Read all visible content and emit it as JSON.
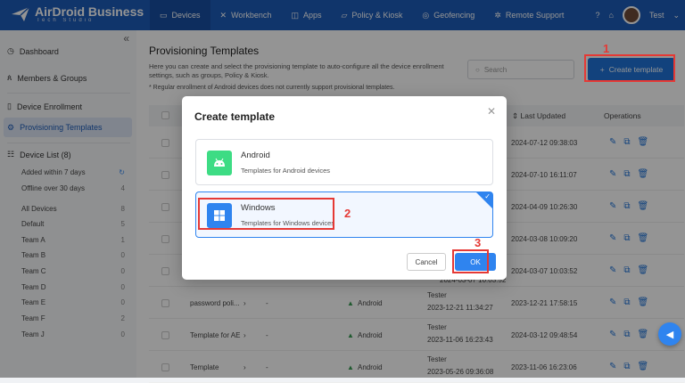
{
  "app": {
    "logo_text": "AirDroid Business",
    "logo_sub": "Tech Studio"
  },
  "nav": [
    {
      "label": "Devices",
      "icon": "devices-icon",
      "active": true
    },
    {
      "label": "Workbench",
      "icon": "workbench-icon"
    },
    {
      "label": "Apps",
      "icon": "apps-icon"
    },
    {
      "label": "Policy & Kiosk",
      "icon": "policy-icon"
    },
    {
      "label": "Geofencing",
      "icon": "geofencing-icon"
    },
    {
      "label": "Remote Support",
      "icon": "remote-support-icon"
    }
  ],
  "user": {
    "name": "Test"
  },
  "sidebar": {
    "dashboard": "Dashboard",
    "members": "Members & Groups",
    "enrollment": "Device Enrollment",
    "provisioning": "Provisioning Templates",
    "device_list": "Device List (8)",
    "filters": [
      {
        "label": "Added within 7 days",
        "count": ""
      },
      {
        "label": "Offline over 30 days",
        "count": "4"
      }
    ],
    "groups": [
      {
        "label": "All Devices",
        "count": "8"
      },
      {
        "label": "Default",
        "count": "5"
      },
      {
        "label": "Team A",
        "count": "1"
      },
      {
        "label": "Team B",
        "count": "0"
      },
      {
        "label": "Team C",
        "count": "0"
      },
      {
        "label": "Team D",
        "count": "0"
      },
      {
        "label": "Team E",
        "count": "0"
      },
      {
        "label": "Team F",
        "count": "2"
      },
      {
        "label": "Team J",
        "count": "0"
      }
    ]
  },
  "page": {
    "title": "Provisioning Templates",
    "desc": "Here you can create and select the provisioning template to auto-configure all the device enrollment settings, such as groups, Policy & Kiosk.",
    "note": "* Regular enrollment of Android devices does not currently support provisional templates.",
    "search_placeholder": "Search",
    "create_label": "Create template"
  },
  "table": {
    "col_updated": "Last Updated",
    "col_ops": "Operations",
    "rows": [
      {
        "name": "",
        "policy": "",
        "platform": "",
        "creator": "",
        "created": "",
        "updated": "2024-07-12 09:38:03"
      },
      {
        "name": "",
        "policy": "",
        "platform": "",
        "creator": "",
        "created": "",
        "updated": "2024-07-10 16:11:07"
      },
      {
        "name": "",
        "policy": "",
        "platform": "",
        "creator": "",
        "created": "",
        "updated": "2024-04-09 10:26:30"
      },
      {
        "name": "",
        "policy": "",
        "platform": "",
        "creator": "",
        "created": "",
        "updated": "2024-03-08 10:09:20"
      },
      {
        "name": "",
        "policy": "",
        "platform": "",
        "creator": "",
        "created": "2024-03-07 10:03:52",
        "updated": "2024-03-07 10:03:52"
      },
      {
        "name": "password poli...",
        "policy": "-",
        "platform": "Android",
        "creator": "Tester",
        "created": "2023-12-21 11:34:27",
        "updated": "2023-12-21 17:58:15"
      },
      {
        "name": "Template for AE",
        "policy": "-",
        "platform": "Android",
        "creator": "Tester",
        "created": "2023-11-06 16:23:43",
        "updated": "2024-03-12 09:48:54"
      },
      {
        "name": "Template",
        "policy": "-",
        "platform": "Android",
        "creator": "Tester",
        "created": "2023-05-26 09:36:08",
        "updated": "2023-11-06 16:23:06"
      }
    ]
  },
  "modal": {
    "title": "Create template",
    "options": [
      {
        "name": "Android",
        "desc": "Templates for Android devices",
        "color": "#3ddc84",
        "selected": false
      },
      {
        "name": "Windows",
        "desc": "Templates for Windows devices",
        "color": "#2f84ef",
        "selected": true
      }
    ],
    "cancel": "Cancel",
    "ok": "OK"
  },
  "annotations": {
    "step1": "1",
    "step2": "2",
    "step3": "3"
  },
  "colors": {
    "brand": "#1d5cb8",
    "accent": "#2f84ef",
    "annotation": "#e53935"
  }
}
